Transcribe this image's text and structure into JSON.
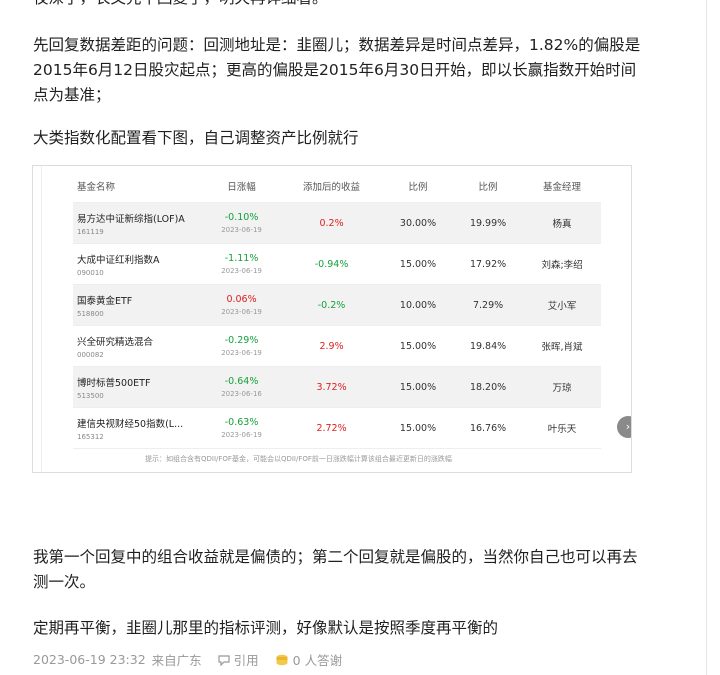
{
  "paragraphs": [
    "夜深了，长文先不回复了，明天再详细看。",
    "先回复数据差距的问题：回测地址是：韭圈儿；数据差异是时间点差异，1.82%的偏股是2015年6月12日股灾起点；更高的偏股是2015年6月30日开始，即以长赢指数开始时间点为基准；",
    "大类指数化配置看下图，自己调整资产比例就行",
    "我第一个回复中的组合收益就是偏债的；第二个回复就是偏股的，当然你自己也可以再去测一次。",
    "定期再平衡，韭圈儿那里的指标评测，好像默认是按照季度再平衡的"
  ],
  "table": {
    "headers": [
      "基金名称",
      "日涨幅",
      "添加后的收益",
      "比例",
      "比例",
      "基金经理"
    ],
    "rows": [
      {
        "name": "易方达中证新综指(LOF)A",
        "code": "161119",
        "change": "-0.10%",
        "date": "2023-06-19",
        "added_return": "0.2%",
        "ratio1": "30.00%",
        "ratio2": "19.99%",
        "manager": "杨真"
      },
      {
        "name": "大成中证红利指数A",
        "code": "090010",
        "change": "-1.11%",
        "date": "2023-06-19",
        "added_return": "-0.94%",
        "ratio1": "15.00%",
        "ratio2": "17.92%",
        "manager": "刘森;李绍"
      },
      {
        "name": "国泰黄金ETF",
        "code": "518800",
        "change": "0.06%",
        "date": "2023-06-19",
        "added_return": "-0.2%",
        "ratio1": "10.00%",
        "ratio2": "7.29%",
        "manager": "艾小军"
      },
      {
        "name": "兴全研究精选混合",
        "code": "000082",
        "change": "-0.29%",
        "date": "2023-06-19",
        "added_return": "2.9%",
        "ratio1": "15.00%",
        "ratio2": "19.84%",
        "manager": "张晖,肖斌"
      },
      {
        "name": "博时标普500ETF",
        "code": "513500",
        "change": "-0.64%",
        "date": "2023-06-16",
        "added_return": "3.72%",
        "ratio1": "15.00%",
        "ratio2": "18.20%",
        "manager": "万琼"
      },
      {
        "name": "建信央视财经50指数(L...",
        "code": "165312",
        "change": "-0.63%",
        "date": "2023-06-19",
        "added_return": "2.72%",
        "ratio1": "15.00%",
        "ratio2": "16.76%",
        "manager": "叶乐天"
      }
    ],
    "tip": "提示：如组合含有QDII/FOF基金，可能会以QDII/FOF前一日涨跌幅计算该组合最近更新日的涨跌幅"
  },
  "meta": {
    "datetime": "2023-06-19 23:32",
    "location": "来自广东",
    "quote_label": "引用",
    "answer_label": "0 人答谢"
  },
  "colors": {
    "up": "#e02020",
    "down": "#15a03c",
    "shade": "#f2f2f2"
  },
  "icons": [
    "quote-icon",
    "coin-icon",
    "scroll-right-icon"
  ]
}
